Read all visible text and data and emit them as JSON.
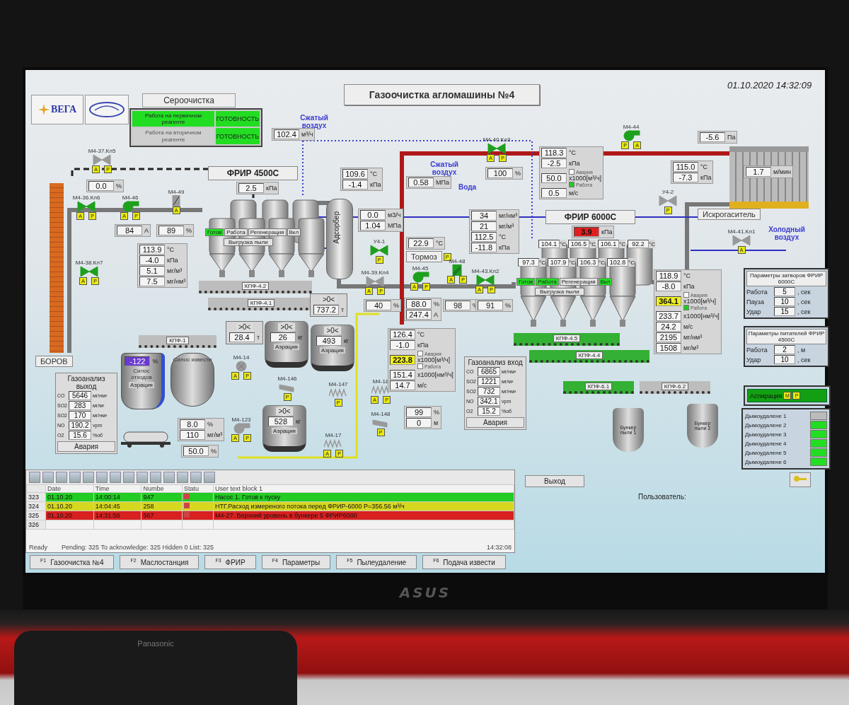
{
  "header": {
    "logo_text": "ВЕГА",
    "title": "Газоочистка агломашины №4",
    "datetime": "01.10.2020 14:32:09"
  },
  "desulfurization": {
    "title": "Сероочистка",
    "modes": [
      {
        "label": "Работа на первичном реагенте",
        "status": "ГОТОВНОСТЬ",
        "active": true
      },
      {
        "label": "Работа на вторичном реагенте",
        "status": "ГОТОВНОСТЬ",
        "active": false
      }
    ]
  },
  "labels": [
    {
      "text": "Сжатый воздух",
      "kind": "air"
    },
    {
      "text": "Сжатый воздух",
      "kind": "air"
    },
    {
      "text": "Вода",
      "kind": "air"
    },
    {
      "text": "Тормоз",
      "kind": "box",
      "badges": [
        "Р"
      ]
    },
    {
      "text": "Искрогаситель",
      "kind": "box"
    },
    {
      "text": "Холодный воздух",
      "kind": "air"
    },
    {
      "text": "БОРОВ",
      "kind": "box"
    },
    {
      "text": "Адсорбер",
      "kind": "vertical"
    }
  ],
  "readouts": [
    {
      "rows": [
        {
          "value": "102.4",
          "unit": "м³/ч"
        }
      ]
    },
    {
      "rows": [
        {
          "value": "0.0",
          "unit": "%"
        }
      ]
    },
    {
      "rows": [
        {
          "value": "2.5",
          "unit": "кПа"
        }
      ]
    },
    {
      "rows": [
        {
          "value": "84",
          "unit": "А"
        }
      ]
    },
    {
      "rows": [
        {
          "value": "89",
          "unit": "%"
        }
      ]
    },
    {
      "rows": [
        {
          "value": "113.9",
          "unit": "°C"
        },
        {
          "value": "-4.0",
          "unit": "кПа"
        },
        {
          "value": "5.1",
          "unit": "мг/м³"
        },
        {
          "value": "7.5",
          "unit": "мг/нм³"
        }
      ]
    },
    {
      "rows": [
        {
          "value": "109.6",
          "unit": "°C"
        },
        {
          "value": "-1.4",
          "unit": "кПа"
        }
      ]
    },
    {
      "rows": [
        {
          "value": "0.0",
          "unit": "м3/ч"
        },
        {
          "value": "1.04",
          "unit": "МПа"
        }
      ]
    },
    {
      "rows": [
        {
          "value": "0.58",
          "unit": "МПа"
        }
      ]
    },
    {
      "rows": [
        {
          "value": "100",
          "unit": "%"
        }
      ]
    },
    {
      "rows": [
        {
          "value": "118.3",
          "unit": "°C"
        },
        {
          "value": "-2.5",
          "unit": "кПа"
        },
        {
          "value": "50.0",
          "unit": "x1000[м³/ч]",
          "flags": [
            {
              "label": "Авария",
              "checked": false
            },
            {
              "label": "Работа",
              "checked": true
            }
          ]
        },
        {
          "value": "0.5",
          "unit": "м/с"
        }
      ]
    },
    {
      "rows": [
        {
          "value": "34",
          "unit": "мг/нм³"
        },
        {
          "value": "21",
          "unit": "мг/м³"
        },
        {
          "value": "112.5",
          "unit": "°C"
        },
        {
          "value": "-11.8",
          "unit": "кПа"
        }
      ]
    },
    {
      "rows": [
        {
          "value": "22.9",
          "unit": "°C"
        }
      ]
    },
    {
      "rows": [
        {
          "value": "40",
          "unit": "%"
        }
      ]
    },
    {
      "rows": [
        {
          "value": "88.0",
          "unit": "%"
        },
        {
          "value": "247.4",
          "unit": "А"
        }
      ]
    },
    {
      "rows": [
        {
          "value": "98",
          "unit": "%"
        }
      ]
    },
    {
      "rows": [
        {
          "value": "91",
          "unit": "%"
        }
      ]
    },
    {
      "rows": [
        {
          "value": "126.4",
          "unit": "°C"
        },
        {
          "value": "-1.0",
          "unit": "кПа"
        },
        {
          "value": "223.8",
          "unit": "x1000[м³/ч]",
          "color": "#f0f020",
          "flags": [
            {
              "label": "Авария",
              "checked": false
            },
            {
              "label": "Работа",
              "checked": false
            }
          ]
        },
        {
          "value": "151.4",
          "unit": "x1000[нм³/ч]"
        },
        {
          "value": "14.7",
          "unit": "м/с"
        }
      ]
    },
    {
      "rows": [
        {
          "value": "3.9",
          "unit": "кПа",
          "color": "#e02020"
        }
      ]
    },
    {
      "rows": [
        {
          "value": "-5.6",
          "unit": "Па"
        }
      ]
    },
    {
      "rows": [
        {
          "value": "115.0",
          "unit": "°C"
        },
        {
          "value": "-7.3",
          "unit": "кПа"
        }
      ]
    },
    {
      "rows": [
        {
          "value": "1.7",
          "unit": "м/мин"
        }
      ]
    },
    {
      "rows": [
        {
          "value": "118.9",
          "unit": "°C"
        },
        {
          "value": "-8.0",
          "unit": "кПа"
        },
        {
          "value": "364.1",
          "unit": "x1000[м³/ч]",
          "color": "#f0f020",
          "flags": [
            {
              "label": "Авария",
              "checked": false
            },
            {
              "label": "Работа",
              "checked": true
            }
          ]
        },
        {
          "value": "233.7",
          "unit": "x1000[нм³/ч]"
        },
        {
          "value": "24.2",
          "unit": "м/с"
        },
        {
          "value": "2195",
          "unit": "мг/нм³"
        },
        {
          "value": "1508",
          "unit": "мг/м³"
        }
      ]
    },
    {
      "rows": [
        {
          "value": "8.0",
          "unit": "%"
        },
        {
          "value": "110",
          "unit": "мг/м³"
        }
      ]
    },
    {
      "rows": [
        {
          "value": "50.0",
          "unit": "%"
        }
      ]
    },
    {
      "rows": [
        {
          "value": "99",
          "unit": "%"
        },
        {
          "value": "0",
          "unit": "м"
        }
      ]
    }
  ],
  "devices": [
    {
      "tag": "М4-37.Кл5",
      "kind": "valve",
      "running": false,
      "badges": [
        "А",
        "Р"
      ]
    },
    {
      "tag": "М4-36.Кл6",
      "kind": "valve",
      "running": true,
      "badges": [
        "А",
        "Р"
      ]
    },
    {
      "tag": "М4-46",
      "kind": "fan",
      "running": true,
      "badges": [
        "А",
        "Р"
      ]
    },
    {
      "tag": "М4-49",
      "kind": "damper",
      "running": false,
      "badges": [
        "А"
      ]
    },
    {
      "tag": "М4-38.Кл7",
      "kind": "valve",
      "running": true,
      "badges": [
        "А",
        "Р"
      ]
    },
    {
      "tag": "У4-1",
      "kind": "valve",
      "running": true,
      "badges": [
        "Р"
      ]
    },
    {
      "tag": "М4-40.Кл3",
      "kind": "valve",
      "running": true,
      "badges": [
        "А",
        "Р"
      ]
    },
    {
      "tag": "М4-39.Кл4",
      "kind": "valve",
      "running": false,
      "badges": [
        "А",
        "Р"
      ]
    },
    {
      "tag": "М4-45",
      "kind": "fan",
      "running": true,
      "badges": [
        "А",
        "Р"
      ]
    },
    {
      "tag": "М4-48",
      "kind": "filter",
      "running": true,
      "badges": [
        "А",
        "Р"
      ]
    },
    {
      "tag": "М4-43.Кл2",
      "kind": "valve",
      "running": true,
      "badges": [
        "А",
        "Р"
      ]
    },
    {
      "tag": "М4-44",
      "kind": "fan",
      "running": true,
      "badges": [
        "Р",
        "А"
      ]
    },
    {
      "tag": "У4-2",
      "kind": "valve",
      "running": false,
      "badges": [
        "Р"
      ]
    },
    {
      "tag": "М4-41.Кл1",
      "kind": "valve",
      "running": false,
      "badges": [
        "А"
      ]
    },
    {
      "tag": "М4-14",
      "kind": "rotary",
      "running": false,
      "badges": [
        "А",
        "Р"
      ]
    },
    {
      "tag": "М4-147",
      "kind": "screw",
      "running": false,
      "badges": [
        "Р"
      ]
    },
    {
      "tag": "М4-18",
      "kind": "screw",
      "running": false,
      "badges": [
        "А",
        "Р"
      ]
    },
    {
      "tag": "М4-146",
      "kind": "gate",
      "running": false,
      "badges": [
        "Р"
      ]
    },
    {
      "tag": "М4-17",
      "kind": "screw",
      "running": false,
      "badges": [
        "А",
        "Р"
      ]
    },
    {
      "tag": "М4-148",
      "kind": "gate",
      "running": false,
      "badges": [
        "Р"
      ]
    },
    {
      "tag": "М4-123",
      "kind": "fan",
      "running": false,
      "badges": [
        "А",
        "Р"
      ]
    }
  ],
  "filter_units": [
    {
      "title": "ФРИР 4500С",
      "states": [
        {
          "label": "Готов",
          "on": true
        },
        {
          "label": "Работа",
          "on": false
        },
        {
          "label": "Регенерация",
          "on": false
        },
        {
          "label": "Вкл",
          "on": false
        }
      ],
      "unload": "Выгрузка пыли"
    },
    {
      "title": "ФРИР 6000С",
      "states": [
        {
          "label": "Готов",
          "on": true
        },
        {
          "label": "Работа",
          "on": true
        },
        {
          "label": "Регенерация",
          "on": false
        },
        {
          "label": "Вкл",
          "on": true
        }
      ],
      "unload": "Выгрузка пыли",
      "temps": [
        {
          "value": "104.1",
          "unit": "°C"
        },
        {
          "value": "106.5",
          "unit": "°C"
        },
        {
          "value": "106.1",
          "unit": "°C"
        },
        {
          "value": "92.2",
          "unit": "°C"
        },
        {
          "value": "97.3",
          "unit": "°C"
        },
        {
          "value": "107.9",
          "unit": "°C"
        },
        {
          "value": "106.3",
          "unit": "°C"
        },
        {
          "value": "102.8",
          "unit": "°C"
        }
      ]
    }
  ],
  "conveyors": [
    {
      "label": "КПФ-4.2",
      "active": false
    },
    {
      "label": "КПФ-4.1",
      "active": false
    },
    {
      "label": "КПФ-1",
      "active": false
    },
    {
      "label": "КПФ-4.5",
      "active": true
    },
    {
      "label": "КПФ-4.4",
      "active": true
    },
    {
      "label": "КПФ-6.1",
      "active": true
    },
    {
      "label": "КПФ-6.2",
      "active": false
    }
  ],
  "tanks": [
    {
      "kind": "scale",
      "title": ">0<",
      "value": "28.4",
      "unit": "т"
    },
    {
      "kind": "hopper",
      "title": ">0<",
      "value": "26",
      "unit": "кг",
      "note": "Аэрация"
    },
    {
      "kind": "scale",
      "title": ">0<",
      "value": "737.2",
      "unit": "т"
    },
    {
      "kind": "hopper",
      "title": ">0<",
      "value": "493",
      "unit": "кг",
      "note": "Аэрация"
    },
    {
      "kind": "hopper",
      "title": ">0<",
      "value": "528",
      "unit": "кг",
      "note": "Аэрация"
    }
  ],
  "silos": [
    {
      "kind": "waste",
      "value": "-122",
      "unit": "%",
      "label": "Силос отходов",
      "note": "Аэрация"
    },
    {
      "kind": "lime",
      "label": "Силос извести"
    }
  ],
  "bunkers": [
    {
      "label": "Бункер пыли 1"
    },
    {
      "label": "Бункер пыли 2"
    }
  ],
  "gas_analyzers": [
    {
      "title": "Газоанализ выход",
      "rows": [
        {
          "gas": "CO",
          "value": "5646",
          "unit": "мг/нм³"
        },
        {
          "gas": "SO2",
          "value": "283",
          "unit": "мг/м³"
        },
        {
          "gas": "SO2",
          "value": "170",
          "unit": "мг/нм³"
        },
        {
          "gas": "NO",
          "value": "190.2",
          "unit": "vpm"
        },
        {
          "gas": "O2",
          "value": "15.6",
          "unit": "%об"
        }
      ],
      "alarm": "Авария"
    },
    {
      "title": "Газоанализ вход",
      "rows": [
        {
          "gas": "CO",
          "value": "6865",
          "unit": "мг/нм³"
        },
        {
          "gas": "SO2",
          "value": "1221",
          "unit": "мг/м³"
        },
        {
          "gas": "SO2",
          "value": "732",
          "unit": "мг/нм³"
        },
        {
          "gas": "NO",
          "value": "342.1",
          "unit": "vpm"
        },
        {
          "gas": "O2",
          "value": "15.2",
          "unit": "%об"
        }
      ],
      "alarm": "Авария"
    }
  ],
  "parameter_panels": [
    {
      "title": "Параметры затворов ФРИР 6000С",
      "rows": [
        {
          "label": "Работа",
          "value": "5",
          "unit": ", сек"
        },
        {
          "label": "Пауза",
          "value": "10",
          "unit": ", сек"
        },
        {
          "label": "Удар",
          "value": "15",
          "unit": ", сек"
        }
      ]
    },
    {
      "title": "Параметры питателей ФРИР 4500С",
      "rows": [
        {
          "label": "Работа",
          "value": "2",
          "unit": ", м"
        },
        {
          "label": "Удар",
          "value": "10",
          "unit": ", сек"
        }
      ]
    }
  ],
  "aspiration": {
    "label": "Аспирация",
    "badges": [
      "М",
      "Р"
    ]
  },
  "smoke_removal": [
    {
      "label": "Дымоудалене 1",
      "on": false
    },
    {
      "label": "Дымоудалене 2",
      "on": true
    },
    {
      "label": "Дымоудалене 3",
      "on": true
    },
    {
      "label": "Дымоудалене 4",
      "on": true
    },
    {
      "label": "Дымоудалене 5",
      "on": true
    },
    {
      "label": "Дымоудалене 6",
      "on": true
    }
  ],
  "alarm_log": {
    "columns": [
      "Date",
      "Time",
      "Numbe",
      "Statu",
      "User text block 1"
    ],
    "rows": [
      {
        "index": "323",
        "date": "01.10.20",
        "time": "14:00:14",
        "number": "947",
        "text": "Насос 1. Готов к пуску",
        "color": "#22cc22"
      },
      {
        "index": "324",
        "date": "01.10.20",
        "time": "14:04:45",
        "number": "258",
        "text": "НТГ.Расход измереного потока перед ФРИР-6000 P=356.56 м³/ч",
        "color": "#d6d820"
      },
      {
        "index": "325",
        "date": "01.10.20",
        "time": "14:31:56",
        "number": "567",
        "text": "М4-27. Верхний уровень в бункере 5 ФРИР6000",
        "color": "#d82020"
      },
      {
        "index": "326"
      }
    ],
    "status": "Ready",
    "counts": "Pending: 325  To acknowledge: 325  Hidden 0  List: 325",
    "clock": "14:32:08"
  },
  "user_label": "Пользователь:",
  "exit_button": "Выход",
  "function_keys": [
    {
      "key": "F1",
      "label": "Газоочистка №4"
    },
    {
      "key": "F2",
      "label": "Маслостанция"
    },
    {
      "key": "F3",
      "label": "ФРИР"
    },
    {
      "key": "F4",
      "label": "Параметры"
    },
    {
      "key": "F5",
      "label": "Пылеудаление"
    },
    {
      "key": "F6",
      "label": "Подача извести"
    }
  ],
  "monitor": {
    "brand": "ASUS"
  },
  "phone": {
    "brand": "Panasonic"
  }
}
